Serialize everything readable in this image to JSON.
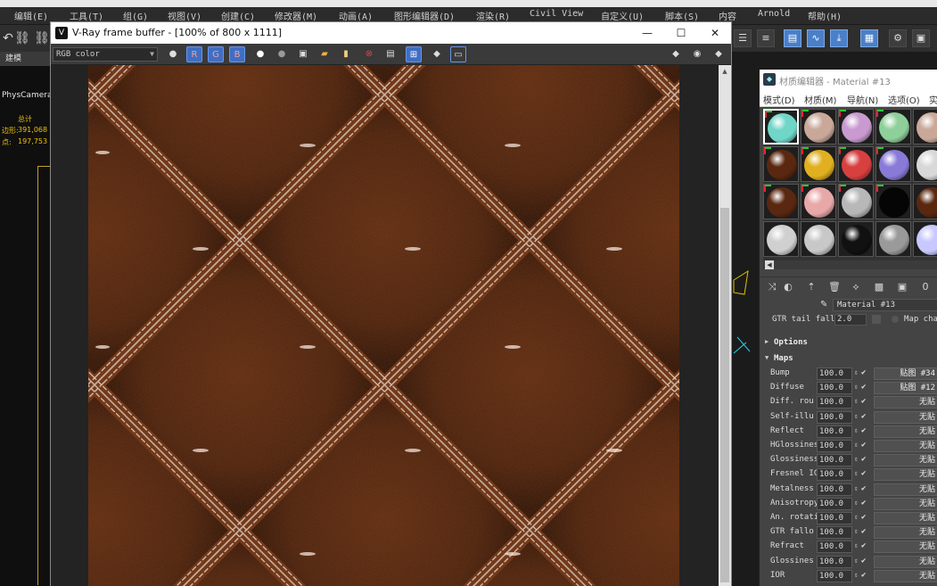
{
  "app": {
    "menubar": [
      "编辑(E)",
      "工具(T)",
      "组(G)",
      "视图(V)",
      "创建(C)",
      "修改器(M)",
      "动画(A)",
      "图形编辑器(D)",
      "渲染(R)",
      "Civil View",
      "自定义(U)",
      "脚本(S)",
      "内容",
      "Arnold",
      "帮助(H)"
    ]
  },
  "left_panel": {
    "tab_label": "建模",
    "viewport_label": "PhysCamera",
    "stats": {
      "total_label": "总计",
      "polys_label": "边形:",
      "polys_value": "391,068",
      "verts_label": "点:",
      "verts_value": "197,753"
    }
  },
  "vfb": {
    "title": "V-Ray frame buffer - [100% of 800 x 1111]",
    "channel": "RGB color",
    "buttons": {
      "r": "R",
      "g": "G",
      "b": "B"
    },
    "colors": {
      "leather_dark": "#3a1808",
      "leather_mid": "#5a2810",
      "stitch": "#e8d6c8",
      "channel_active": "#3f6fc4"
    }
  },
  "material_editor": {
    "title": "材质编辑器 - Material #13",
    "menu": [
      "模式(D)",
      "材质(M)",
      "导航(N)",
      "选项(O)",
      "实"
    ],
    "material_name": "Material #13",
    "gtr": {
      "label": "GTR tail fall",
      "value": "2.0",
      "map_channel_label": "Map chan"
    },
    "rollouts": {
      "options": "Options",
      "maps": "Maps"
    },
    "maps": [
      {
        "name": "Bump",
        "value": "100.0",
        "map": "贴图 #34"
      },
      {
        "name": "Diffuse",
        "value": "100.0",
        "map": "贴图 #12"
      },
      {
        "name": "Diff. rou",
        "value": "100.0",
        "map": "无贴"
      },
      {
        "name": "Self-illu",
        "value": "100.0",
        "map": "无贴"
      },
      {
        "name": "Reflect",
        "value": "100.0",
        "map": "无贴"
      },
      {
        "name": "HGlossines",
        "value": "100.0",
        "map": "无贴"
      },
      {
        "name": "Glossiness",
        "value": "100.0",
        "map": "无贴"
      },
      {
        "name": "Fresnel IC",
        "value": "100.0",
        "map": "无贴"
      },
      {
        "name": "Metalness",
        "value": "100.0",
        "map": "无贴"
      },
      {
        "name": "Anisotropy",
        "value": "100.0",
        "map": "无贴"
      },
      {
        "name": "An. rotati",
        "value": "100.0",
        "map": "无贴"
      },
      {
        "name": "GTR fallo",
        "value": "100.0",
        "map": "无贴"
      },
      {
        "name": "Refract",
        "value": "100.0",
        "map": "无贴"
      },
      {
        "name": "Glossines",
        "value": "100.0",
        "map": "无贴"
      },
      {
        "name": "IOR",
        "value": "100.0",
        "map": "无贴"
      }
    ],
    "slot_colors": [
      [
        "#6fd6c8",
        "#c9a89a",
        "#c89ad0",
        "#8fd09a",
        "#c9a89a"
      ],
      [
        "#5a2810",
        "#e0b020",
        "#d84040",
        "#8a7ad8",
        "#d8d8d8"
      ],
      [
        "#5a2810",
        "#e8a8a8",
        "#b8b8b8",
        "#050505",
        "#5a2810"
      ],
      [
        "#d0d0d0",
        "#c8c8c8",
        "#111111",
        "#9a9a9a",
        "#c8c8ff"
      ]
    ]
  }
}
